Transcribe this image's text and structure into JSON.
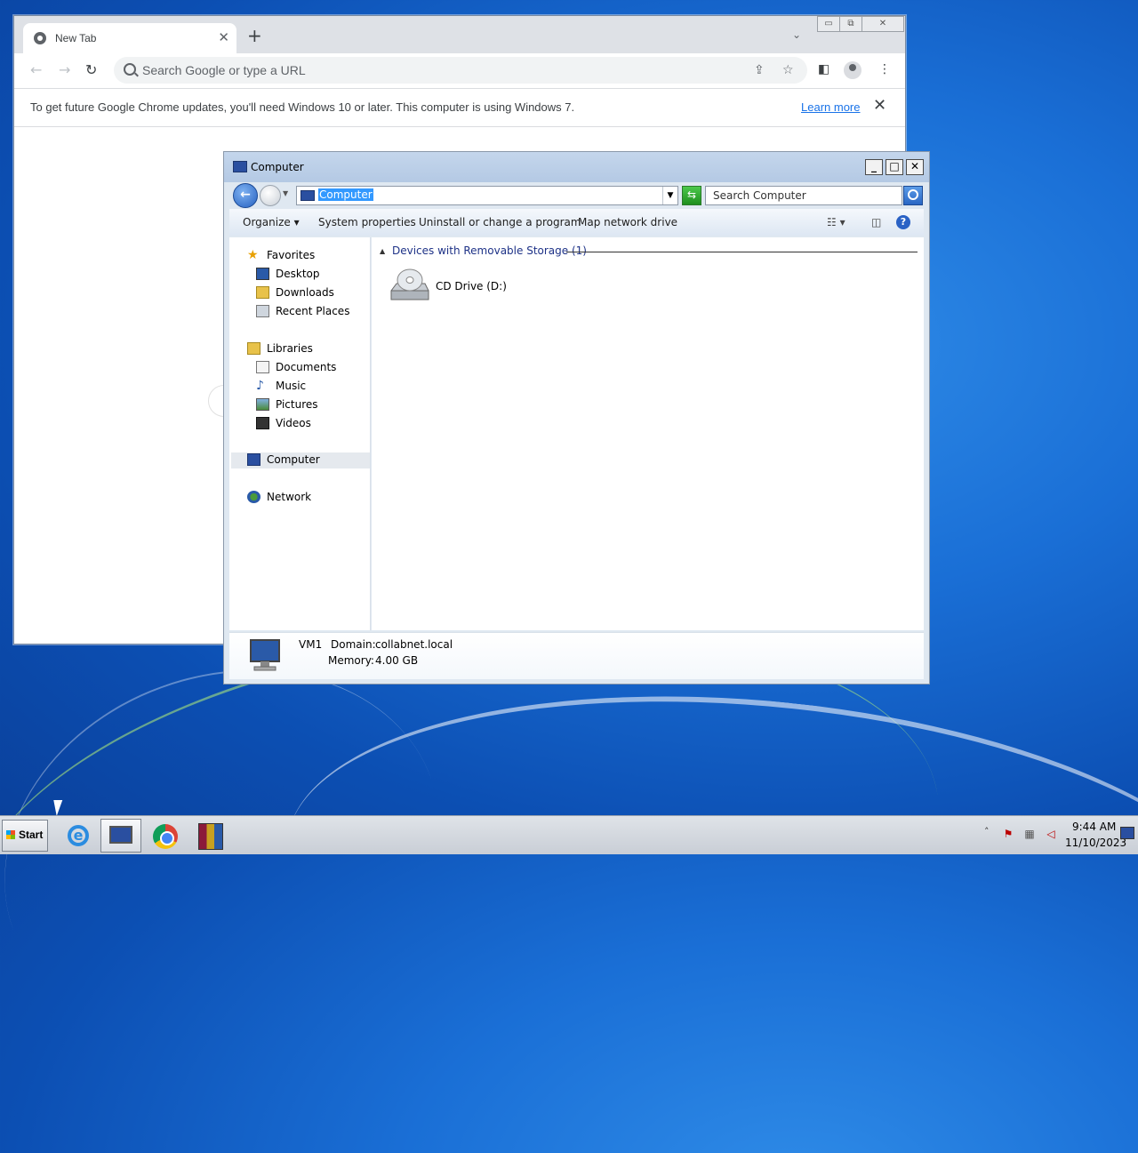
{
  "chrome": {
    "tab_title": "New Tab",
    "tab_close": "✕",
    "new_tab": "+",
    "tab_search": "⌄",
    "window_controls": [
      "▭",
      "⧉",
      "✕"
    ],
    "back": "←",
    "forward": "→",
    "reload": "↻",
    "omnibox_placeholder": "Search Google or type a URL",
    "share_icon": "⇪",
    "bookmark_icon": "☆",
    "sidepanel_icon": "◧",
    "menu_icon": "⋮",
    "infobar_message": "To get future Google Chrome updates, you'll need Windows 10 or later. This computer is using Windows 7.",
    "infobar_link": "Learn more",
    "infobar_close": "✕"
  },
  "explorer": {
    "title": "Computer",
    "controls": [
      "_",
      "□",
      "✕"
    ],
    "address": "Computer",
    "search_placeholder": "Search Computer",
    "commands": {
      "organize": "Organize ▾",
      "system_properties": "System properties",
      "uninstall": "Uninstall or change a program",
      "map_drive": "Map network drive",
      "view_icon": "☷ ▾",
      "preview_icon": "◫",
      "help": "?"
    },
    "nav": {
      "favorites": "Favorites",
      "desktop": "Desktop",
      "downloads": "Downloads",
      "recent": "Recent Places",
      "libraries": "Libraries",
      "documents": "Documents",
      "music": "Music",
      "pictures": "Pictures",
      "videos": "Videos",
      "computer": "Computer",
      "network": "Network"
    },
    "group_title": "Devices with Removable Storage (1)",
    "drive_label": "CD Drive (D:)",
    "details": {
      "name": "VM1",
      "domain_label": "Domain:",
      "domain": "collabnet.local",
      "memory_label": "Memory:",
      "memory": "4.00 GB"
    }
  },
  "taskbar": {
    "start": "Start",
    "apps": [
      "internet-explorer",
      "windows-explorer",
      "google-chrome",
      "winrar"
    ],
    "tray_up": "˄",
    "time": "9:44 AM",
    "date": "11/10/2023"
  }
}
